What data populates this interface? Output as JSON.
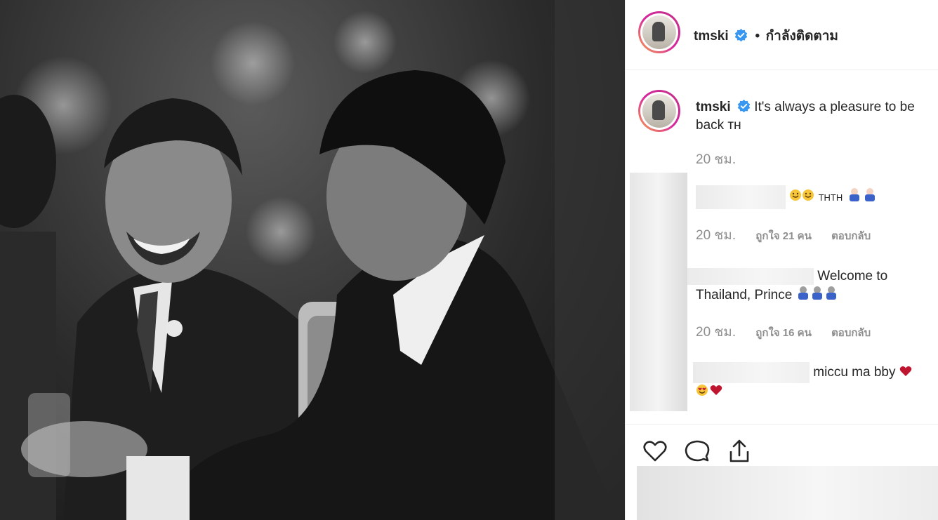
{
  "post": {
    "username": "tmski",
    "following_separator": "•",
    "following_label": "กำลังติดตาม",
    "caption_text": "It's always a pleasure to be back ᴛʜ",
    "caption_time": "20 ชม."
  },
  "comments": [
    {
      "text": "THTH",
      "time": "20 ชม.",
      "likes": "ถูกใจ 21 คน",
      "reply": "ตอบกลับ"
    },
    {
      "text_line1": "Welcome to",
      "text_line2": "Thailand, Prince",
      "time": "20 ชม.",
      "likes": "ถูกใจ 16 คน",
      "reply": "ตอบกลับ"
    },
    {
      "text": "miccu ma bby"
    }
  ],
  "actions": {
    "like": "heart-icon",
    "comment": "comment-icon",
    "share": "share-icon"
  },
  "colors": {
    "story_ring_start": "#f9a64a",
    "story_ring_end": "#c13584",
    "verified": "#3897f0",
    "heart": "#c0152f",
    "muted": "#8e8e8e"
  }
}
